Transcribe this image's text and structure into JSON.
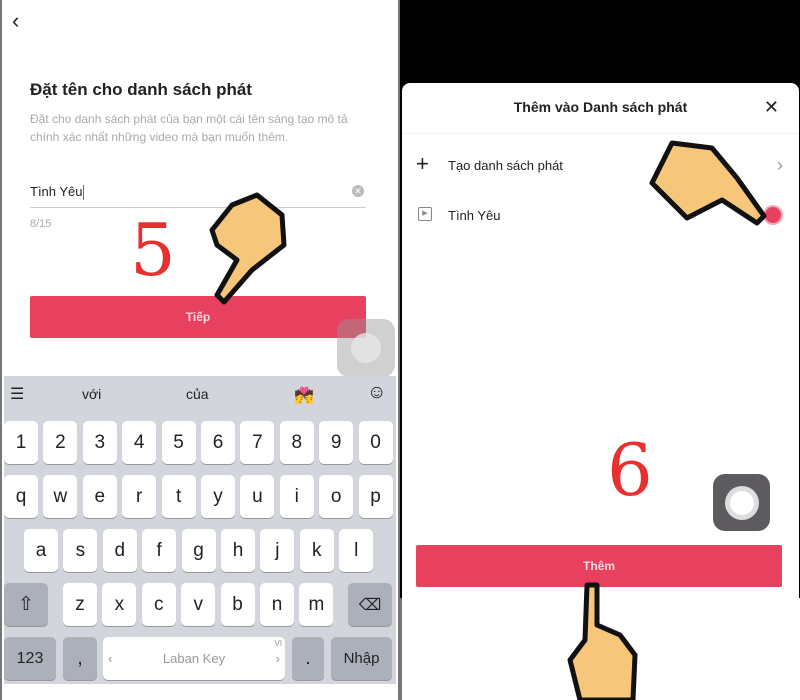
{
  "left": {
    "back_icon": "chevron-left",
    "title": "Đặt tên cho danh sách phát",
    "description": "Đặt cho danh sách phát của bạn một cái tên sáng tạo mô tả chính xác nhất những video mà bạn muốn thêm.",
    "input_value": "Tình Yêu",
    "char_count": "8/15",
    "next_label": "Tiếp",
    "step_label": "5"
  },
  "keyboard": {
    "suggestions": [
      "với",
      "của"
    ],
    "number_row": [
      "1",
      "2",
      "3",
      "4",
      "5",
      "6",
      "7",
      "8",
      "9",
      "0"
    ],
    "row1": [
      "q",
      "w",
      "e",
      "r",
      "t",
      "y",
      "u",
      "i",
      "o",
      "p"
    ],
    "row2": [
      "a",
      "s",
      "d",
      "f",
      "g",
      "h",
      "j",
      "k",
      "l"
    ],
    "row3": [
      "z",
      "x",
      "c",
      "v",
      "b",
      "n",
      "m"
    ],
    "numbers_key": "123",
    "comma_key": ",",
    "space_label": "Laban Key",
    "lang_label": "VI",
    "period_key": ".",
    "enter_key": "Nhập"
  },
  "right": {
    "sheet_title": "Thêm vào Danh sách phát",
    "create_label": "Tạo danh sách phát",
    "playlist_name": "Tình Yêu",
    "add_label": "Thêm",
    "step_label": "6",
    "playlist_selected": true,
    "accent": "#e8415f"
  }
}
